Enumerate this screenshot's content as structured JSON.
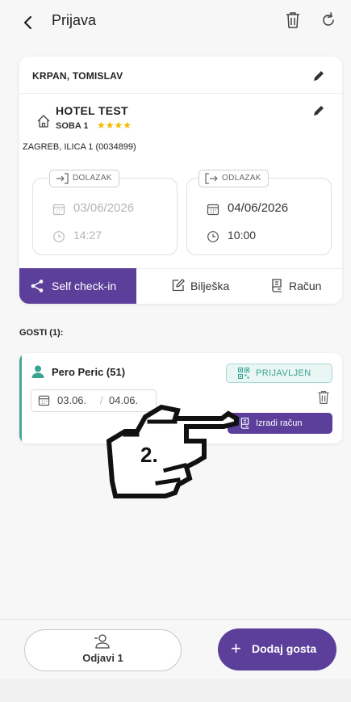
{
  "header": {
    "title": "Prijava"
  },
  "reservation": {
    "guest_name": "KRPAN, TOMISLAV",
    "hotel_name": "HOTEL TEST",
    "room": "SOBA 1",
    "stars": "★★★★",
    "star_rating": 4,
    "address": "ZAGREB, ILICA 1 (0034899)",
    "arrival": {
      "label": "DOLAZAK",
      "date": "03/06/2026",
      "time": "14:27"
    },
    "departure": {
      "label": "ODLAZAK",
      "date": "04/06/2026",
      "time": "10:00"
    }
  },
  "actions": {
    "self_checkin": "Self check-in",
    "note": "Bilješka",
    "invoice": "Račun"
  },
  "guests": {
    "header": "GOSTI (1):",
    "items": [
      {
        "name": "Pero Peric (51)",
        "status": "PRIJAVLJEN",
        "date_from": "03.06.",
        "date_separator": "/",
        "date_to": "04.06.",
        "create_invoice": "Izradi račun"
      }
    ]
  },
  "annotation": {
    "label": "2."
  },
  "bottom": {
    "checkout": "Odjavi 1",
    "add_guest": "Dodaj gosta"
  },
  "colors": {
    "accent": "#5b3f9a",
    "status": "#3aa394",
    "stars": "#f5b800"
  }
}
